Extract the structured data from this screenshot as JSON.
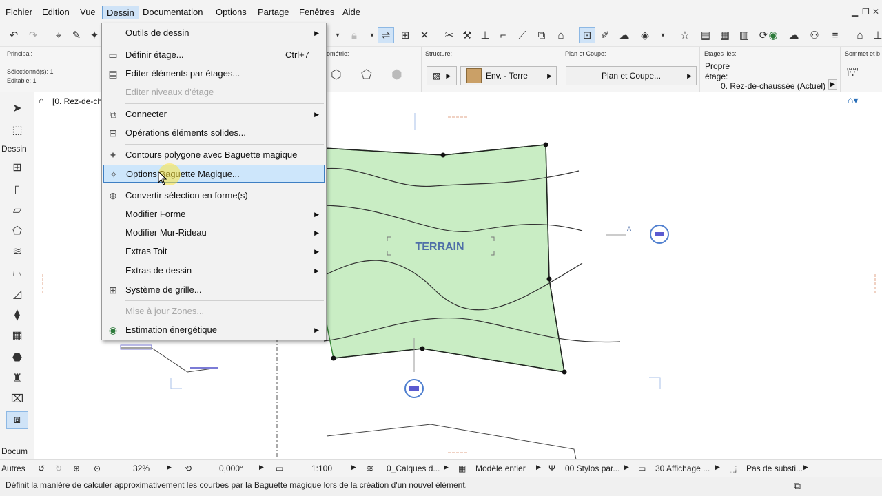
{
  "menubar": {
    "items": [
      "Fichier",
      "Edition",
      "Vue",
      "Dessin",
      "Documentation",
      "Options",
      "Partage",
      "Fenêtres",
      "Aide"
    ],
    "active": "Dessin"
  },
  "infobox": {
    "principal": "Principal:",
    "selected": "Sélectionné(s): 1",
    "editable": "Editable: 1",
    "geometry": "ométrie:",
    "structure": "Structure:",
    "structure_value": "Env. - Terre",
    "plan_coupe_label": "Plan et Coupe:",
    "plan_coupe_value": "Plan et Coupe...",
    "etages_lies": "Etages liés:",
    "propre": "Propre",
    "etage": "étage:",
    "etage_value": "0. Rez-de-chaussée (Actuel)",
    "sommet": "Sommet et b"
  },
  "navbar": {
    "tab": "[0. Rez-de-ch"
  },
  "toolbox": {
    "section_dessin": "Dessin",
    "section_docum": "Docum",
    "section_autres": "Autres"
  },
  "canvas": {
    "terrain_label": "TERRAIN",
    "marker_a": "A"
  },
  "dropdown": {
    "items": [
      {
        "label": "Outils de dessin",
        "icon": "",
        "submenu": true,
        "disabled": false
      },
      {
        "label": "Définir étage...",
        "icon": "floor-icon",
        "shortcut": "Ctrl+7",
        "disabled": false
      },
      {
        "label": "Editer éléments par étages...",
        "icon": "stories-icon",
        "disabled": false
      },
      {
        "label": "Editer niveaux d'étage",
        "icon": "",
        "disabled": true
      },
      {
        "label": "Connecter",
        "icon": "connect-icon",
        "submenu": true,
        "disabled": false
      },
      {
        "label": "Opérations éléments solides...",
        "icon": "solid-ops-icon",
        "disabled": false
      },
      {
        "label": "Contours polygone avec Baguette magique",
        "icon": "magic-wand-icon",
        "disabled": false
      },
      {
        "label": "Options Baguette Magique...",
        "icon": "magic-wand-options-icon",
        "disabled": false,
        "highlighted": true
      },
      {
        "label": "Convertir sélection en forme(s)",
        "icon": "convert-icon",
        "disabled": false
      },
      {
        "label": "Modifier Forme",
        "icon": "",
        "submenu": true,
        "disabled": false
      },
      {
        "label": "Modifier Mur-Rideau",
        "icon": "",
        "submenu": true,
        "disabled": false
      },
      {
        "label": "Extras Toit",
        "icon": "",
        "submenu": true,
        "disabled": false
      },
      {
        "label": "Extras de dessin",
        "icon": "",
        "submenu": true,
        "disabled": false
      },
      {
        "label": "Système de grille...",
        "icon": "grid-icon",
        "disabled": false
      },
      {
        "label": "Mise à jour Zones...",
        "icon": "",
        "disabled": true
      },
      {
        "label": "Estimation énergétique",
        "icon": "energy-icon",
        "submenu": true,
        "disabled": false
      }
    ]
  },
  "statusbar": {
    "zoom": "32%",
    "angle": "0,000°",
    "scale": "1:100",
    "layers": "0_Calques d...",
    "model": "Modèle entier",
    "pens": "00 Stylos par...",
    "display": "30 Affichage ...",
    "subst": "Pas de substi..."
  },
  "hint": "Définit la manière de calculer approximativement les courbes par la Baguette magique lors de la création d'un nouvel élément."
}
